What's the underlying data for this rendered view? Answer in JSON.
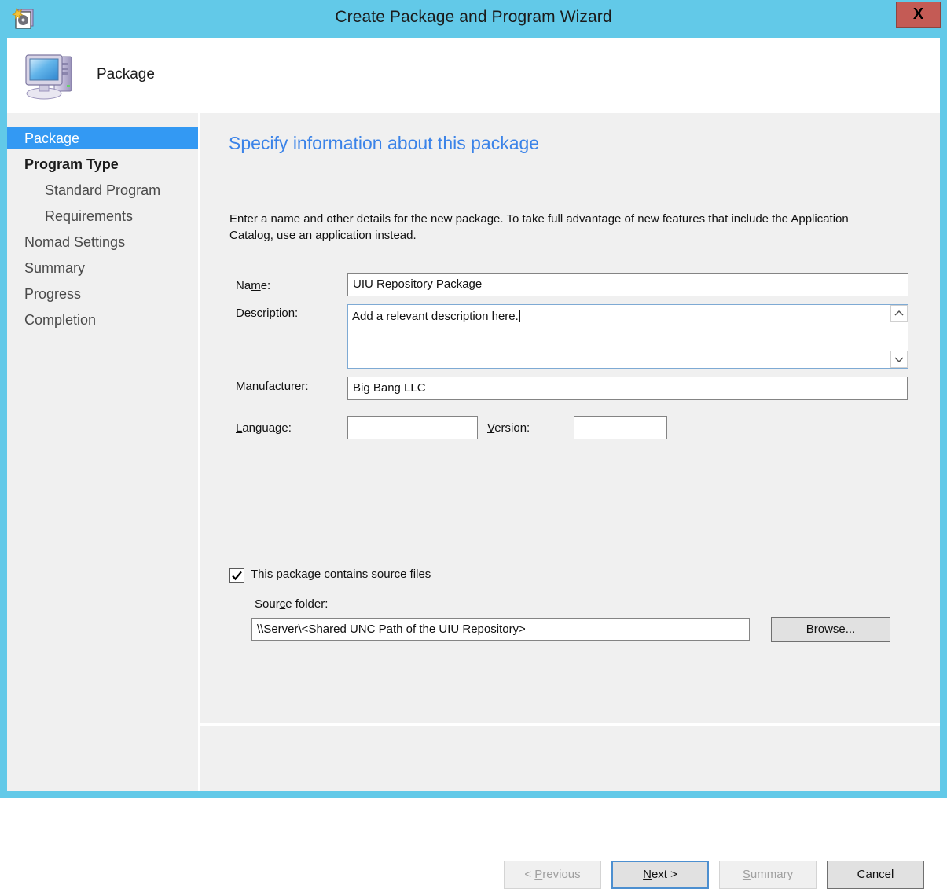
{
  "window": {
    "title": "Create Package and Program Wizard",
    "title_icon": "package-disc-icon",
    "close_label": "X",
    "frame_color": "#62C9E8",
    "close_bg": "#C45B55"
  },
  "header": {
    "title": "Package",
    "icon": "computer-monitor-icon"
  },
  "sidebar": {
    "selected_color": "#3399F3",
    "items": [
      {
        "label": "Package",
        "state": "selected",
        "indent": false
      },
      {
        "label": "Program Type",
        "state": "bold",
        "indent": false
      },
      {
        "label": "Standard Program",
        "state": "normal",
        "indent": true
      },
      {
        "label": "Requirements",
        "state": "normal",
        "indent": true
      },
      {
        "label": "Nomad Settings",
        "state": "normal",
        "indent": false
      },
      {
        "label": "Summary",
        "state": "normal",
        "indent": false
      },
      {
        "label": "Progress",
        "state": "normal",
        "indent": false
      },
      {
        "label": "Completion",
        "state": "normal",
        "indent": false
      }
    ]
  },
  "main": {
    "heading": "Specify information about this package",
    "heading_color": "#3B83E8",
    "description": "Enter a name and other details for the new package. To take full advantage of new features that include the Application Catalog, use an application instead.",
    "fields": {
      "name": {
        "label_pre": "Na",
        "label_accel": "m",
        "label_post": "e:",
        "value": "UIU Repository Package",
        "placeholder": ""
      },
      "description": {
        "label_pre": "",
        "label_accel": "D",
        "label_post": "escription:",
        "value": "Add a relevant description here.",
        "placeholder": "",
        "focused": true
      },
      "manufacturer": {
        "label_pre": "Manufactur",
        "label_accel": "e",
        "label_post": "r:",
        "value": "Big Bang LLC",
        "placeholder": ""
      },
      "language": {
        "label_pre": "",
        "label_accel": "L",
        "label_post": "anguage:",
        "value": "",
        "placeholder": ""
      },
      "version": {
        "label_pre": "",
        "label_accel": "V",
        "label_post": "ersion:",
        "value": "",
        "placeholder": ""
      },
      "source_checkbox": {
        "label_pre": "",
        "label_accel": "T",
        "label_post": "his package contains source files",
        "checked": true,
        "check_glyph": "✔"
      },
      "source_folder": {
        "label_pre": "Sour",
        "label_accel": "c",
        "label_post": "e folder:",
        "value": "\\\\Server\\<Shared UNC Path of the UIU Repository>",
        "placeholder": ""
      }
    },
    "browse_button": {
      "label_pre": "B",
      "label_accel": "r",
      "label_post": "owse..."
    },
    "scrollbar": {
      "up_icon": "chevron-up-icon",
      "down_icon": "chevron-down-icon"
    }
  },
  "footer": {
    "buttons": [
      {
        "name": "previous",
        "label_pre": "< ",
        "label_accel": "P",
        "label_post": "revious",
        "state": "disabled"
      },
      {
        "name": "next",
        "label_pre": "",
        "label_accel": "N",
        "label_post": "ext >",
        "state": "default"
      },
      {
        "name": "summary",
        "label_pre": "",
        "label_accel": "S",
        "label_post": "ummary",
        "state": "disabled"
      },
      {
        "name": "cancel",
        "label_pre": "Cancel",
        "label_accel": "",
        "label_post": "",
        "state": "normal"
      }
    ]
  }
}
